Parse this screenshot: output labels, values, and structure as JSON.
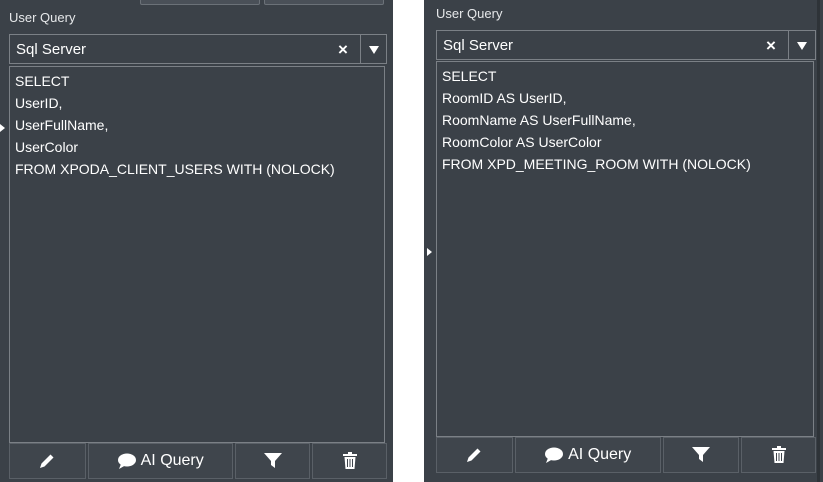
{
  "left_panel": {
    "title": "User Query",
    "db_select": {
      "value": "Sql Server",
      "clear_glyph": "×"
    },
    "query_lines": [
      "SELECT",
      "UserID,",
      "UserFullName,",
      "UserColor",
      "FROM XPODA_CLIENT_USERS WITH (NOLOCK)"
    ],
    "toolbar": {
      "edit_icon": "pencil-icon",
      "ai_label": "AI Query",
      "ai_icon": "chat-bubble-icon",
      "filter_icon": "funnel-icon",
      "delete_icon": "trash-icon"
    }
  },
  "right_panel": {
    "title": "User Query",
    "db_select": {
      "value": "Sql Server",
      "clear_glyph": "×"
    },
    "query_lines": [
      "SELECT",
      "RoomID AS UserID,",
      "RoomName AS UserFullName,",
      "RoomColor AS UserColor",
      "FROM XPD_MEETING_ROOM WITH (NOLOCK)"
    ],
    "toolbar": {
      "edit_icon": "pencil-icon",
      "ai_label": "AI Query",
      "ai_icon": "chat-bubble-icon",
      "filter_icon": "funnel-icon",
      "delete_icon": "trash-icon"
    }
  },
  "colors": {
    "panel_bg": "#3b4148",
    "border": "#7b8086",
    "text": "#ffffff",
    "button_bg": "#3f454c"
  }
}
